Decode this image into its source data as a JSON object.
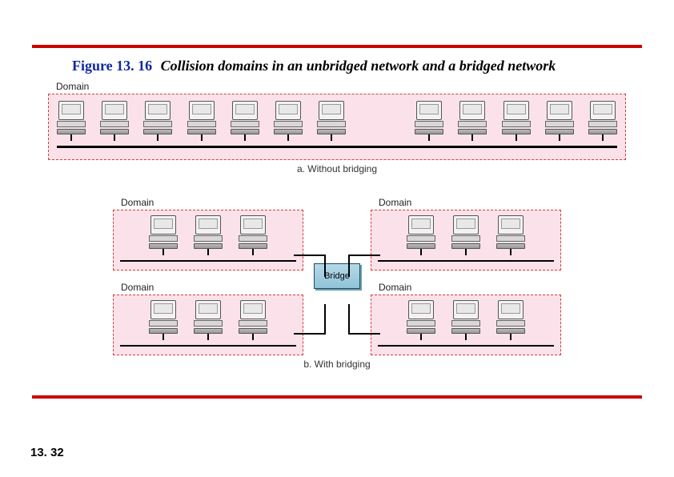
{
  "figure": {
    "number": "Figure 13. 16",
    "caption": "Collision domains in an unbridged network and a bridged network"
  },
  "domain_label": "Domain",
  "diagram_a": {
    "caption": "a. Without bridging",
    "host_count": 12
  },
  "diagram_b": {
    "caption": "b. With bridging",
    "bridge_label": "Bridge",
    "quadrants": [
      {
        "label": "Domain",
        "host_count": 3
      },
      {
        "label": "Domain",
        "host_count": 3
      },
      {
        "label": "Domain",
        "host_count": 3
      },
      {
        "label": "Domain",
        "host_count": 3
      }
    ]
  },
  "page_number": "13. 32"
}
